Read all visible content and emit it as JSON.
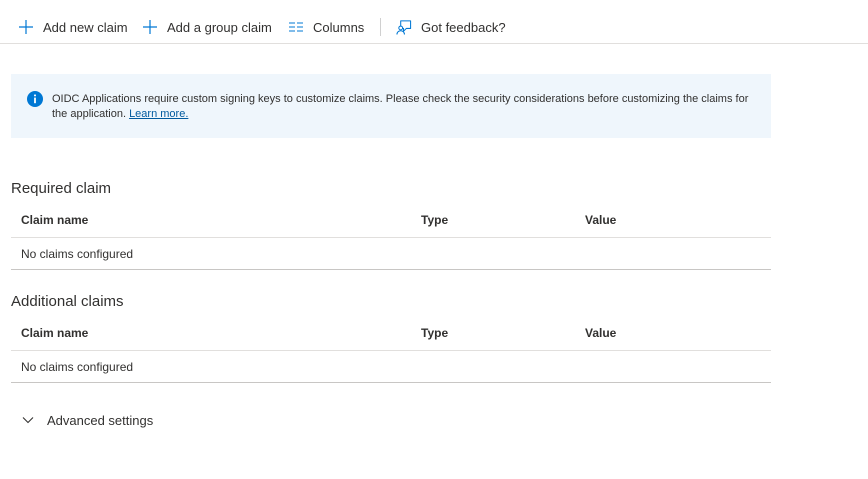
{
  "toolbar": {
    "add_new_claim": "Add new claim",
    "add_group_claim": "Add a group claim",
    "columns": "Columns",
    "feedback": "Got feedback?"
  },
  "info": {
    "message": "OIDC Applications require custom signing keys to customize claims. Please check the security considerations before customizing the claims for the application.",
    "link": "Learn more."
  },
  "required": {
    "title": "Required claim",
    "columns": [
      "Claim name",
      "Type",
      "Value"
    ],
    "empty": "No claims configured"
  },
  "additional": {
    "title": "Additional claims",
    "columns": [
      "Claim name",
      "Type",
      "Value"
    ],
    "empty": "No claims configured"
  },
  "advanced": {
    "label": "Advanced settings"
  },
  "colors": {
    "accent": "#0078d4",
    "info_background": "#eff6fc",
    "link": "#005a9e"
  }
}
